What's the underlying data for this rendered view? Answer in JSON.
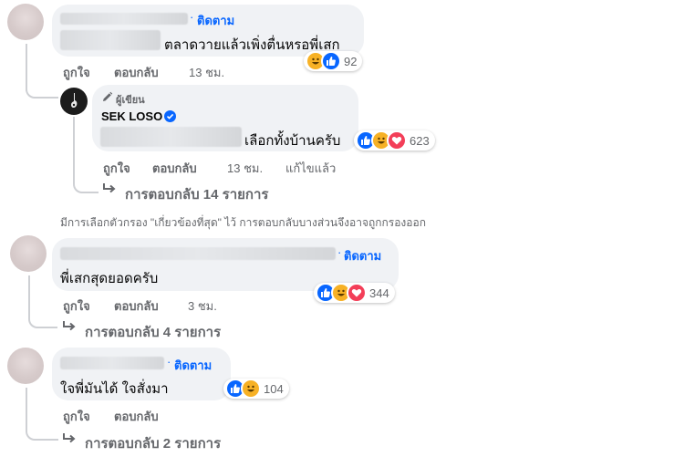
{
  "comment1": {
    "follow_label": "ติดตาม",
    "text": "ตลาดวายแล้วเพิ่งตื่นหรอพี่เสก",
    "reaction_count": "92",
    "like_label": "ถูกใจ",
    "reply_label": "ตอบกลับ",
    "time": "13 ชม."
  },
  "author_reply": {
    "badge_label": "ผู้เขียน",
    "name": "SEK LOSO",
    "text": "เลือกทั้งบ้านครับ",
    "reaction_count": "623",
    "like_label": "ถูกใจ",
    "reply_label": "ตอบกลับ",
    "time": "13 ชม.",
    "edited_label": "แก้ไขแล้ว",
    "replies_label": "การตอบกลับ 14 รายการ"
  },
  "filter_notice": "มีการเลือกตัวกรอง \"เกี่ยวข้องที่สุด\" ไว้ การตอบกลับบางส่วนจึงอาจถูกกรองออก",
  "comment2": {
    "follow_label": "ติดตาม",
    "text": "พี่เสกสุดยอดครับ",
    "reaction_count": "344",
    "like_label": "ถูกใจ",
    "reply_label": "ตอบกลับ",
    "time": "3 ชม.",
    "replies_label": "การตอบกลับ 4 รายการ"
  },
  "comment3": {
    "follow_label": "ติดตาม",
    "text": "ใจพี่มันได้ ใจสั่งมา",
    "reaction_count": "104",
    "like_label": "ถูกใจ",
    "reply_label": "ตอบกลับ",
    "replies_label": "การตอบกลับ 2 รายการ"
  },
  "colors": {
    "accent": "#0866ff",
    "bubble": "#f0f2f5",
    "secondary_text": "#65676b",
    "like": "#0866ff",
    "haha": "#f7b125",
    "love": "#f33e58"
  }
}
